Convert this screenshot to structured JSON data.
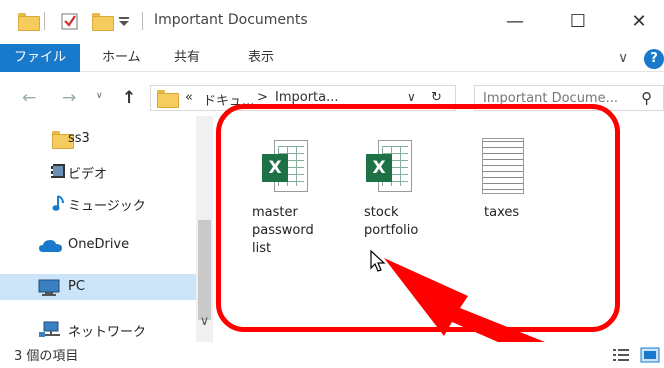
{
  "window": {
    "title": "Important Documents",
    "minimize_glyph": "—",
    "maximize_glyph": "☐",
    "close_glyph": "✕"
  },
  "ribbon": {
    "tabs": [
      "ファイル",
      "ホーム",
      "共有",
      "表示"
    ],
    "expand_glyph": "∨",
    "help_glyph": "?"
  },
  "address": {
    "back_glyph": "←",
    "forward_glyph": "→",
    "up_glyph": "↑",
    "overflow": "«",
    "crumbs": [
      "ドキュ...",
      ">",
      "Importa..."
    ],
    "dropdown_glyph": "∨",
    "refresh_glyph": "↻",
    "search_placeholder": "Important Docume...",
    "search_glyph": "⚲"
  },
  "sidebar": {
    "items": [
      {
        "label": "ss3",
        "icon": "folder-icon"
      },
      {
        "label": "ビデオ",
        "icon": "video-icon"
      },
      {
        "label": "ミュージック",
        "icon": "music-icon"
      },
      {
        "label": "OneDrive",
        "icon": "cloud-icon"
      },
      {
        "label": "PC",
        "icon": "computer-icon"
      },
      {
        "label": "ネットワーク",
        "icon": "network-icon"
      }
    ],
    "scroll_down_glyph": "∨"
  },
  "files": [
    {
      "name": "master password list",
      "lines": [
        "master",
        "password",
        "list"
      ],
      "type": "excel",
      "icon_letter": "X"
    },
    {
      "name": "stock portfolio",
      "lines": [
        "stock",
        "portfolio"
      ],
      "type": "excel",
      "icon_letter": "X"
    },
    {
      "name": "taxes",
      "lines": [
        "taxes"
      ],
      "type": "text"
    }
  ],
  "status": {
    "count_text": "3 個の項目"
  },
  "colors": {
    "accent": "#1979ca",
    "selection": "#cce4f7",
    "excel_green": "#1e7145",
    "annotation_red": "#ff0000"
  }
}
